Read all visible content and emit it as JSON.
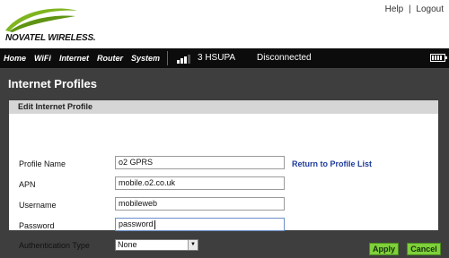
{
  "brand": {
    "logo_text": "NOVATEL WIRELESS."
  },
  "top_links": {
    "help": "Help",
    "separator": "|",
    "logout": "Logout"
  },
  "nav": {
    "items": [
      "Home",
      "WiFi",
      "Internet",
      "Router",
      "System"
    ],
    "network": "3 HSUPA",
    "connection_status": "Disconnected",
    "signal_bars": 3,
    "battery_level": 1.0
  },
  "page": {
    "title": "Internet Profiles"
  },
  "panel": {
    "header": "Edit Internet Profile",
    "return_link": "Return to Profile List",
    "fields": {
      "profile_name": {
        "label": "Profile Name",
        "value": "o2 GPRS"
      },
      "apn": {
        "label": "APN",
        "value": "mobile.o2.co.uk"
      },
      "username": {
        "label": "Username",
        "value": "mobileweb"
      },
      "password": {
        "label": "Password",
        "value": "password"
      },
      "auth_type": {
        "label": "Authentication Type",
        "value": "None"
      }
    }
  },
  "buttons": {
    "apply": "Apply",
    "cancel": "Cancel"
  },
  "colors": {
    "accent_green": "#7fd03a",
    "nav_bg": "#0c0c0c",
    "link_blue": "#1f3c9a"
  }
}
